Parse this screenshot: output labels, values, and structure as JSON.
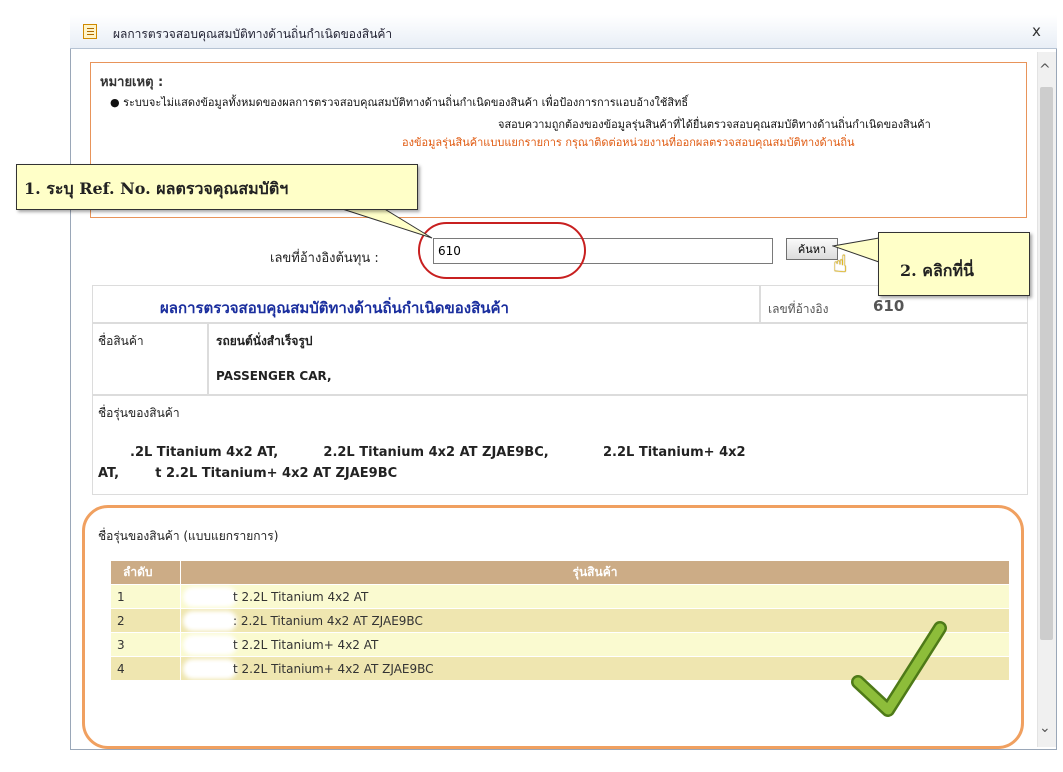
{
  "window": {
    "title": "ผลการตรวจสอบคุณสมบัติทางด้านถิ่นกำเนิดของสินค้า",
    "close_label": "x"
  },
  "scrollbar": {
    "up": "^",
    "down": "⌄"
  },
  "note": {
    "title": "หมายเหตุ :",
    "bullet1": "●  ระบบจะไม่แสดงข้อมูลทั้งหมดของผลการตรวจสอบคุณสมบัติทางด้านถิ่นกำเนิดของสินค้า เพื่อป้องการการแอบอ้างใช้สิทธิ์",
    "line2": "จสอบความถูกต้องของข้อมูลรุ่นสินค้าที่ได้ยื่นตรวจสอบคุณสมบัติทางด้านถิ่นกำเนิดของสินค้า",
    "line3": "องข้อมูลรุ่นสินค้าแบบแยกรายการ กรุณาติดต่อหน่วยงานที่ออกผลตรวจสอบคุณสมบัติทางด้านถิ่น"
  },
  "search": {
    "label": "เลขที่อ้างอิงต้นทุน :",
    "value": "610",
    "button_label": "ค้นหา"
  },
  "callouts": {
    "step1": "1. ระบุ Ref. No. ผลตรวจคุณสมบัติฯ",
    "step2": "2. คลิกที่นี่"
  },
  "result": {
    "title": "ผลการตรวจสอบคุณสมบัติทางด้านถิ่นกำเนิดของสินค้า",
    "ref_label": "เลขที่อ้างอิง",
    "ref_value": "610",
    "product_name_label": "ชื่อสินค้า",
    "product_name_th": "รถยนต์นั่งสำเร็จรูป",
    "product_name_en": "PASSENGER CAR,",
    "model_label": "ชื่อรุ่นของสินค้า",
    "model_line1": ".2L Titanium 4x2 AT,          2.2L Titanium 4x2 AT ZJAE9BC,            2.2L Titanium+ 4x2",
    "model_line2": "AT,        t 2.2L Titanium+ 4x2 AT ZJAE9BC",
    "itemized_label": "ชื่อรุ่นของสินค้า (แบบแยกรายการ)"
  },
  "item_table": {
    "headers": [
      "ลำดับ",
      "รุ่นสินค้า"
    ],
    "rows": [
      {
        "no": "1",
        "model": "t 2.2L Titanium 4x2 AT"
      },
      {
        "no": "2",
        "model": ": 2.2L Titanium 4x2 AT ZJAE9BC"
      },
      {
        "no": "3",
        "model": "t 2.2L Titanium+ 4x2 AT"
      },
      {
        "no": "4",
        "model": "t 2.2L Titanium+ 4x2 AT ZJAE9BC"
      }
    ]
  },
  "colors": {
    "title_blue": "#1a2e9e",
    "note_orange": "#e05a10",
    "header_tan": "#ccac86",
    "callout_yellow": "#ffffc8",
    "highlight_red": "#c82020",
    "frame_orange": "#f0a060",
    "check_green": "#7aa830"
  },
  "icons": {
    "title_icon": "document-icon",
    "cursor": "hand-pointer-icon",
    "check": "checkmark-icon"
  }
}
